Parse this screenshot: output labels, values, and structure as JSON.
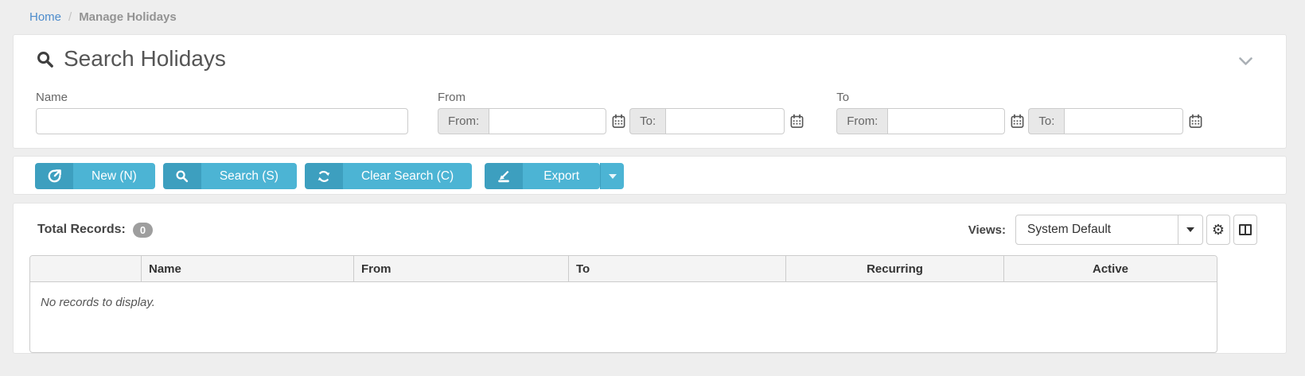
{
  "breadcrumb": {
    "home": "Home",
    "separator": "/",
    "current": "Manage Holidays"
  },
  "search_panel": {
    "title": "Search Holidays",
    "name_label": "Name",
    "from_label": "From",
    "to_label": "To",
    "range_from_prefix": "From:",
    "range_to_prefix": "To:",
    "name_value": "",
    "date_values": {
      "from_from": "",
      "from_to": "",
      "to_from": "",
      "to_to": ""
    }
  },
  "toolbar": {
    "new_label": "New (N)",
    "search_label": "Search (S)",
    "clear_label": "Clear Search (C)",
    "export_label": "Export"
  },
  "results": {
    "total_records_label": "Total Records:",
    "total_records_count": "0",
    "views_label": "Views:",
    "views_selected": "System Default",
    "empty_message": "No records to display."
  },
  "table": {
    "columns": [
      "",
      "Name",
      "From",
      "To",
      "Recurring",
      "Active"
    ]
  },
  "colors": {
    "accent": "#4cb4d4",
    "accent_dark": "#3d9fbf",
    "link_blue": "#4d8ccc",
    "badge_gray": "#9e9e9e",
    "page_background": "#eeeeee"
  }
}
